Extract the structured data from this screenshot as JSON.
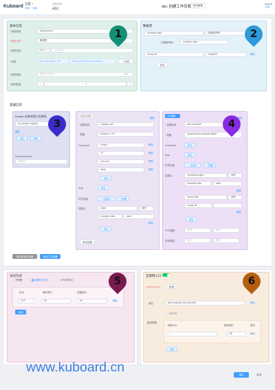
{
  "header": {
    "logo": "Kuboard",
    "breadcrumb": {
      "level1": "设置",
      "level2a": "名称",
      "level2b": "功能"
    },
    "namespace": {
      "label": "名称空间",
      "value": "abc"
    },
    "title": "abc 创建工作负载",
    "cancel": "取消编辑",
    "user": {
      "line1": "admin",
      "line2": "注销"
    }
  },
  "basic": {
    "title": "基本信息",
    "type": {
      "label": "服务类型",
      "value": "Deployment"
    },
    "layer": {
      "label": "服务分层",
      "value": "展现层"
    },
    "name": {
      "label": "服务名称",
      "prefix": "web-",
      "placeholder": "example"
    },
    "labels": {
      "label": "标签",
      "tag1": "k8s.eip.work/layer: web",
      "tag2": "k8s.eip.work/name: web-example",
      "add": "+ 标签"
    },
    "desc": {
      "label": "服务描述",
      "placeholder": "描述 Example",
      "counter": "0/30"
    },
    "replicas": {
      "label": "副本数量",
      "minus": "−",
      "value": "1",
      "plus": "+"
    }
  },
  "volumes": {
    "title": "数据卷",
    "row1": {
      "name": "example-data",
      "type": "存储卷声明",
      "delete": "删除"
    },
    "row1b": {
      "label": "存储卷声明",
      "value": "example-data"
    },
    "row2": {
      "name": "empty-dir",
      "type": "emptyDir",
      "delete": "删除"
    },
    "add": "添加"
  },
  "containers": {
    "title": "容器信息",
    "docker": {
      "title": "Docker 仓库的用户名密码",
      "value": "my-docker-registry",
      "delete": "删除",
      "add": "添加",
      "refresh": "刷新"
    },
    "sa": {
      "label": "ServiceAccount",
      "placeholder": "请选择"
    },
    "c1": {
      "tag": "初始化容器",
      "delete": "删除",
      "name": {
        "label": "容器名称",
        "value": "change-own"
      },
      "image": {
        "label": "镜像",
        "value": "busybox:1.29"
      },
      "command": {
        "label": "Command",
        "items": [
          "chown",
          "-R",
          "root:root",
          "/data"
        ],
        "delete": "删除",
        "add": "添加"
      },
      "args": {
        "label": "Args",
        "add": "添加"
      },
      "env": {
        "label": "环境变量",
        "add_var": "+ 名值对",
        "add_ref": "+ 配置"
      },
      "mount": {
        "label": "挂载点",
        "name": "/data",
        "mode": "读写",
        "volume": "example-data",
        "sub": "data",
        "delete": "删除",
        "add": "添加"
      },
      "add_container": "添加容器"
    },
    "c2": {
      "tag": "工作容器",
      "delete": "删除",
      "name": {
        "label": "容器名称",
        "value": "web-example"
      },
      "image": {
        "label": "镜像",
        "value": "eipwork/web-example:latest"
      },
      "command": {
        "label": "Command",
        "add": "添加"
      },
      "args": {
        "label": "Args",
        "add": "添加"
      },
      "env": {
        "label": "环境变量",
        "add_var": "+ 名值对",
        "add_ref": "+ 配置"
      },
      "mount": {
        "label": "挂载点",
        "r1": "/usr/share/nginx",
        "r1mode": "读写",
        "r1vol": "example-data",
        "r1sub": "data",
        "r2": "/temp-data",
        "r2mode": "读写",
        "r2vol": "empty-dir",
        "delete": "删除",
        "add": "添加"
      },
      "cpu": {
        "label": "CPU限制",
        "req": "请求",
        "lim": "限制"
      },
      "mem": {
        "label": "内存限制",
        "req": "请求",
        "lim": "限制"
      }
    },
    "add_init": "添加初始化容器",
    "add_work": "添加工作容器"
  },
  "access": {
    "title": "访问方式",
    "opt1": "不配置",
    "opt2": "集群内访问",
    "opt3": "VPC内访问",
    "headers": {
      "proto": "协议",
      "svc": "服务端口",
      "container": "容器端口"
    },
    "row": {
      "proto": "TCP",
      "svc": "80",
      "container": "80",
      "delete": "删除"
    },
    "add": "添加"
  },
  "ingress": {
    "title": "互联网入口",
    "warning": "ingressName",
    "add_domain": "+ 新增",
    "domain": {
      "label": "域名",
      "value": "web-example.abc.zip.work",
      "delete": "删除"
    },
    "https": "HTTPS",
    "route": {
      "label": "路由配置",
      "h_path": "映射URL",
      "h_port": "服务端口",
      "h_op": "操作",
      "path": "/",
      "port": "80",
      "delete": "删除"
    },
    "add": "添加"
  },
  "footer": {
    "save": "保存",
    "cancel": "取消"
  },
  "watermark": "www.kuboard.cn",
  "pins": [
    "1",
    "2",
    "3",
    "4",
    "5",
    "6"
  ],
  "colors": {
    "pin1": "#148f77",
    "pin2": "#2e9ad8",
    "pin3": "#3a2bcc",
    "pin4": "#8a2be2",
    "pin5": "#7b1a4f",
    "pin6": "#b25f10"
  }
}
